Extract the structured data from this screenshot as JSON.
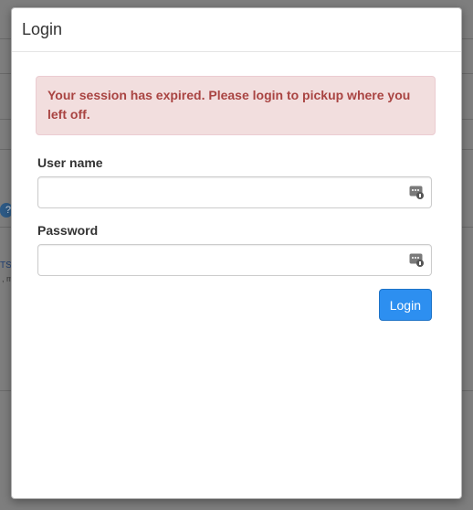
{
  "background": {
    "help_glyph": "?",
    "snippet_a": "TS",
    "snippet_b": ", m"
  },
  "modal": {
    "title": "Login",
    "alert_message": "Your session has expired. Please login to pickup where you left off.",
    "username": {
      "label": "User name",
      "value": "",
      "placeholder": "",
      "icon": "password-manager-icon"
    },
    "password": {
      "label": "Password",
      "value": "",
      "placeholder": "",
      "icon": "password-manager-icon"
    },
    "login_button": "Login"
  },
  "colors": {
    "primary_button": "#2d8ff0",
    "alert_background": "#f2dede",
    "alert_text": "#a94442",
    "overlay": "#7e7e7e"
  }
}
